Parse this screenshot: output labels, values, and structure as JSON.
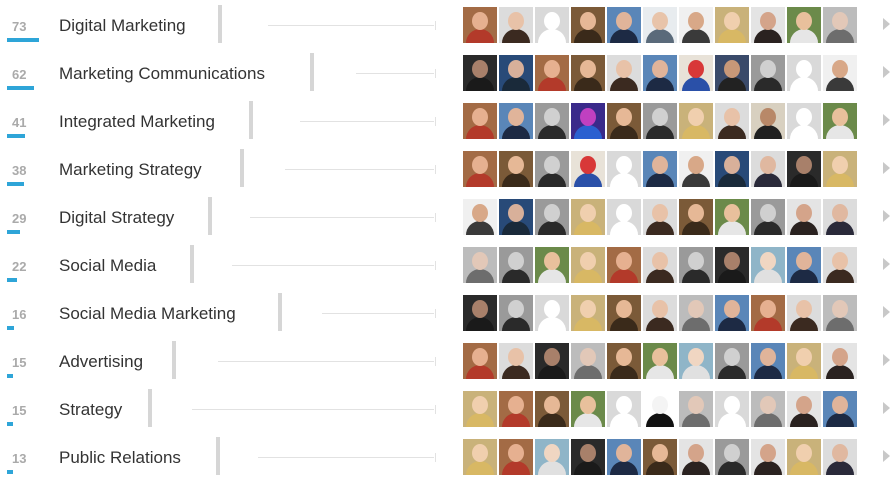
{
  "skills": [
    {
      "count": "73",
      "count_fraction": 1.0,
      "label": "Digital Marketing",
      "faces": [
        "photo-woman-red",
        "photo-woman-brown",
        "placeholder",
        "photo-man-blond",
        "photo-man-suit",
        "photo-man-light",
        "photo-man-curly",
        "photo-woman-blond",
        "photo-woman-dark",
        "photo-man-smile",
        "photo-woman-grey"
      ]
    },
    {
      "count": "62",
      "count_fraction": 0.85,
      "label": "Marketing Communications",
      "faces": [
        "photo-man-dark",
        "photo-man-blue",
        "photo-woman-red",
        "photo-man-blond",
        "photo-woman-brown",
        "photo-man-suit",
        "photo-slide",
        "photo-man-tall",
        "photo-man-bw",
        "placeholder",
        "photo-man-curly"
      ]
    },
    {
      "count": "41",
      "count_fraction": 0.56,
      "label": "Integrated Marketing",
      "faces": [
        "photo-woman-red",
        "photo-man-suit",
        "photo-man-bw",
        "photo-concert",
        "photo-man-blond",
        "photo-man-bw",
        "photo-woman-blond",
        "photo-woman-brown",
        "photo-man-sunglasses",
        "placeholder",
        "photo-man-smile"
      ]
    },
    {
      "count": "38",
      "count_fraction": 0.52,
      "label": "Marketing Strategy",
      "faces": [
        "photo-woman-red",
        "photo-man-blond",
        "photo-man-bw",
        "photo-slide",
        "placeholder",
        "photo-man-suit",
        "photo-man-curly",
        "photo-man-blue",
        "photo-man-bald",
        "photo-man-dark",
        "photo-woman-blond"
      ]
    },
    {
      "count": "29",
      "count_fraction": 0.4,
      "label": "Digital Strategy",
      "faces": [
        "photo-man-curly",
        "photo-man-blue",
        "photo-man-bw",
        "photo-woman-blond",
        "placeholder",
        "photo-woman-brown",
        "photo-man-blond",
        "photo-man-smile",
        "photo-man-bw",
        "photo-woman-dark",
        "photo-man-bald"
      ]
    },
    {
      "count": "22",
      "count_fraction": 0.3,
      "label": "Social Media",
      "faces": [
        "photo-woman-grey",
        "photo-man-bw",
        "photo-man-smile",
        "photo-woman-blond",
        "photo-woman-red",
        "photo-woman-brown",
        "photo-man-bw",
        "photo-man-dark",
        "photo-woman-light",
        "photo-man-suit",
        "photo-woman-brown",
        "photo-man-bald"
      ]
    },
    {
      "count": "16",
      "count_fraction": 0.22,
      "label": "Social Media Marketing",
      "faces": [
        "photo-man-dark",
        "photo-man-bw",
        "placeholder",
        "photo-woman-blond",
        "photo-man-blond",
        "photo-woman-brown",
        "photo-woman-grey",
        "photo-man-suit",
        "photo-woman-red",
        "photo-woman-brown",
        "photo-woman-grey"
      ]
    },
    {
      "count": "15",
      "count_fraction": 0.2,
      "label": "Advertising",
      "faces": [
        "photo-woman-red",
        "photo-woman-brown",
        "photo-man-dark",
        "photo-woman-grey",
        "photo-man-blond",
        "photo-man-smile",
        "photo-woman-light",
        "photo-man-bw",
        "photo-man-suit",
        "photo-woman-blond",
        "photo-woman-dark"
      ]
    },
    {
      "count": "15",
      "count_fraction": 0.2,
      "label": "Strategy",
      "faces": [
        "photo-woman-blond",
        "photo-woman-red",
        "photo-man-blond",
        "photo-man-smile",
        "placeholder",
        "photo-man-drawing",
        "photo-woman-grey",
        "placeholder",
        "photo-woman-grey",
        "photo-woman-dark",
        "photo-man-suit"
      ]
    },
    {
      "count": "13",
      "count_fraction": 0.18,
      "label": "Public Relations",
      "faces": [
        "photo-woman-blond",
        "photo-woman-red",
        "photo-woman-light",
        "photo-man-dark",
        "photo-man-suit",
        "photo-man-blond",
        "photo-woman-dark",
        "photo-man-bw",
        "photo-woman-dark",
        "photo-woman-blond",
        "photo-man-bald",
        "photo-woman-grey"
      ]
    }
  ],
  "colors": {
    "accent": "#2ea5d8",
    "count_text": "#aaaaaa",
    "label_text": "#333333",
    "divider": "#d6d6d6",
    "connector": "#e2e2e2",
    "arrow": "#c8c8c8"
  },
  "icons": {
    "row_arrow": "chevron-right-icon",
    "avatar": "avatar-icon",
    "placeholder_avatar": "placeholder-avatar-icon"
  }
}
